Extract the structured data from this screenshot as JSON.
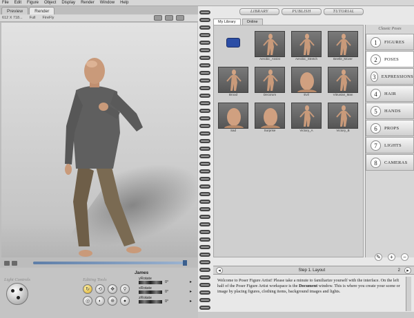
{
  "menu": [
    "File",
    "Edit",
    "Figure",
    "Object",
    "Display",
    "Render",
    "Window",
    "Help"
  ],
  "left_tabs": [
    "Preview",
    "Render"
  ],
  "left_tab_active": "Render",
  "doc_toolbar": {
    "size": "612 X 718...",
    "mode": "Full",
    "renderer": "FireFly"
  },
  "light_label": "Light Controls",
  "edit_label": "Editing Tools",
  "params": {
    "figure": "James",
    "rows": [
      {
        "label": "yRotate",
        "value": "0°"
      },
      {
        "label": "xRotate",
        "value": "0°"
      },
      {
        "label": "zRotate",
        "value": "0°"
      }
    ]
  },
  "timeline_progress": 1.0,
  "right_tabs": [
    "LIBRARY",
    "PUBLISH",
    "TUTORIAL"
  ],
  "sub_tabs": [
    "My Library",
    "Online"
  ],
  "library_items": [
    {
      "caption": "",
      "kind": "folder"
    },
    {
      "caption": "Aerobic_Assist",
      "kind": "figure"
    },
    {
      "caption": "Aerobic_Stretch",
      "kind": "figure"
    },
    {
      "caption": "Beetle_Mover",
      "kind": "figure"
    },
    {
      "caption": "Brood",
      "kind": "figure"
    },
    {
      "caption": "Decorum",
      "kind": "figure"
    },
    {
      "caption": "Evil",
      "kind": "head"
    },
    {
      "caption": "Vitruvian_Man",
      "kind": "figure"
    },
    {
      "caption": "Sad",
      "kind": "head"
    },
    {
      "caption": "Surprise",
      "kind": "head"
    },
    {
      "caption": "Victory_A",
      "kind": "figure"
    },
    {
      "caption": "Victory_B",
      "kind": "figure"
    }
  ],
  "category_title": "Classic Poses",
  "categories": [
    {
      "num": "1",
      "label": "FIGURES"
    },
    {
      "num": "2",
      "label": "POSES"
    },
    {
      "num": "3",
      "label": "EXPRESSIONS"
    },
    {
      "num": "4",
      "label": "HAIR"
    },
    {
      "num": "5",
      "label": "HANDS"
    },
    {
      "num": "6",
      "label": "PROPS"
    },
    {
      "num": "7",
      "label": "LIGHTS"
    },
    {
      "num": "8",
      "label": "CAMERAS"
    }
  ],
  "active_category": "POSES",
  "step": {
    "label": "Step 1. Layout",
    "num": "2"
  },
  "welcome": {
    "p1": "Welcome to Poser Figure Artist! Please take a minute to familiarize yourself with the interface. On the left half of the Poser Figure Artist workspace is the ",
    "p1_bold": "Document",
    "p1_end": " window. This is where you create your scene or image by placing figures, clothing items, background images and lights."
  }
}
